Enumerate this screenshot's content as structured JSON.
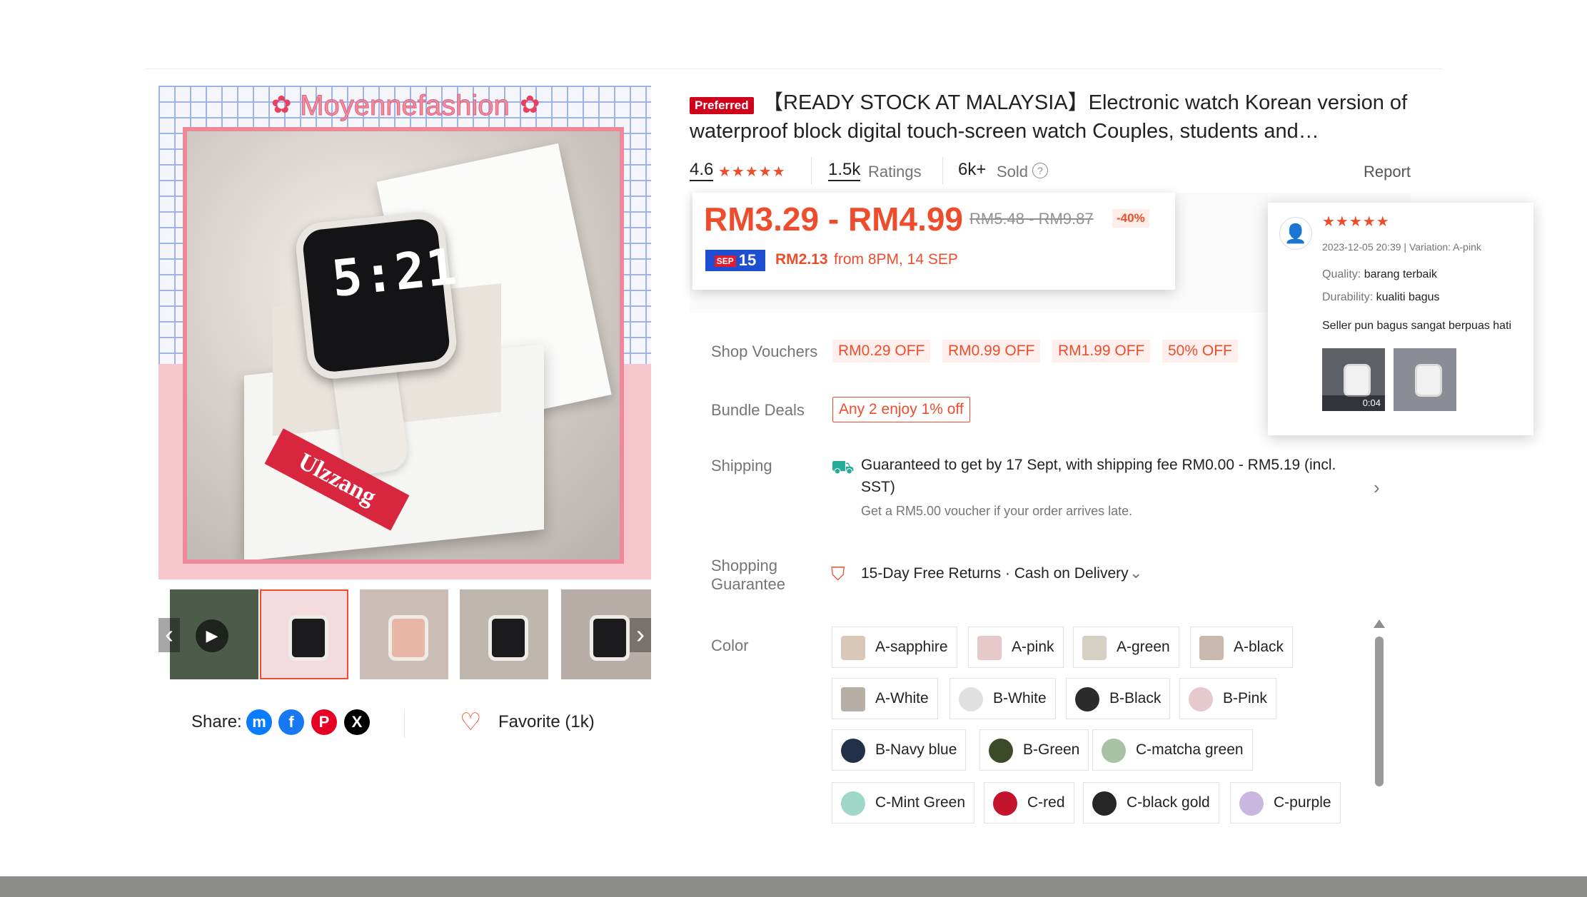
{
  "product": {
    "badge": "Preferred",
    "title": "【READY STOCK AT MALAYSIA】Electronic watch Korean version of waterproof block digital touch-screen watch Couples, students and…",
    "image_brand_text": "Moyennefashion",
    "image_label_text": "Ulzzang",
    "watch_digits": "5:21",
    "rating": "4.6",
    "stars": "★★★★★",
    "ratings_count": "1.5k",
    "ratings_label": "Ratings",
    "sold_count": "6k+",
    "sold_label": "Sold",
    "help_icon": "?",
    "report_label": "Report"
  },
  "price": {
    "range": "RM3.29 - RM4.99",
    "original": "RM5.48 - RM9.87",
    "discount": "-40%",
    "sale_badge_small": "SEP",
    "sale_badge_big": "15",
    "sale_price": "RM2.13",
    "sale_time": "from 8PM, 14 SEP"
  },
  "vouchers": {
    "label": "Shop Vouchers",
    "items": [
      "RM0.29 OFF",
      "RM0.99 OFF",
      "RM1.99 OFF",
      "50% OFF"
    ]
  },
  "bundle": {
    "label": "Bundle Deals",
    "deal": "Any 2 enjoy 1% off"
  },
  "shipping": {
    "label": "Shipping",
    "text": "Guaranteed to get by 17 Sept, with shipping fee RM0.00 - RM5.19 (incl. SST)",
    "sub": "Get a RM5.00 voucher if your order arrives late.",
    "icon": "truck-icon"
  },
  "guarantee": {
    "label_line1": "Shopping",
    "label_line2": "Guarantee",
    "text": "15-Day Free Returns · Cash on Delivery",
    "icon": "shield-icon"
  },
  "color": {
    "label": "Color",
    "options": [
      {
        "name": "A-sapphire",
        "swatch": "#d9c7b8"
      },
      {
        "name": "A-pink",
        "swatch": "#e8c9c9"
      },
      {
        "name": "A-green",
        "swatch": "#d6cfc4"
      },
      {
        "name": "A-black",
        "swatch": "#c9b8ad"
      },
      {
        "name": "A-White",
        "swatch": "#b7aea6"
      },
      {
        "name": "B-White",
        "swatch": "#e0e0e0"
      },
      {
        "name": "B-Black",
        "swatch": "#2b2b2b"
      },
      {
        "name": "B-Pink",
        "swatch": "#e6c9cd"
      },
      {
        "name": "B-Navy blue",
        "swatch": "#23304a"
      },
      {
        "name": "B-Green",
        "swatch": "#3b4b2a"
      },
      {
        "name": "C-matcha green",
        "swatch": "#a8c2a4"
      },
      {
        "name": "C-Mint Green",
        "swatch": "#9fd8c8"
      },
      {
        "name": "C-red",
        "swatch": "#c4142c"
      },
      {
        "name": "C-black gold",
        "swatch": "#262626"
      },
      {
        "name": "C-purple",
        "swatch": "#c9b7e0"
      }
    ]
  },
  "share": {
    "label": "Share:",
    "icons": [
      {
        "name": "messenger-icon",
        "glyph": "m",
        "color": "#0a7cff"
      },
      {
        "name": "facebook-icon",
        "glyph": "f",
        "color": "#1877f2"
      },
      {
        "name": "pinterest-icon",
        "glyph": "P",
        "color": "#e60023"
      },
      {
        "name": "x-icon",
        "glyph": "X",
        "color": "#000000"
      }
    ]
  },
  "favorite": {
    "label": "Favorite (1k)",
    "icon": "heart-outline-icon"
  },
  "review": {
    "stars": "★★★★★",
    "meta": "2023-12-05 20:39 | Variation: A-pink",
    "quality_key": "Quality:",
    "quality_val": "barang terbaik",
    "durability_key": "Durability:",
    "durability_val": "kualiti bagus",
    "comment": "Seller pun bagus sangat berpuas hati",
    "video_duration": "0:04"
  },
  "colors": {
    "accent": "#ee4d2d",
    "preferred_badge": "#d0011b",
    "sale_badge": "#1e4fd0",
    "shipping_icon": "#26aa99"
  }
}
